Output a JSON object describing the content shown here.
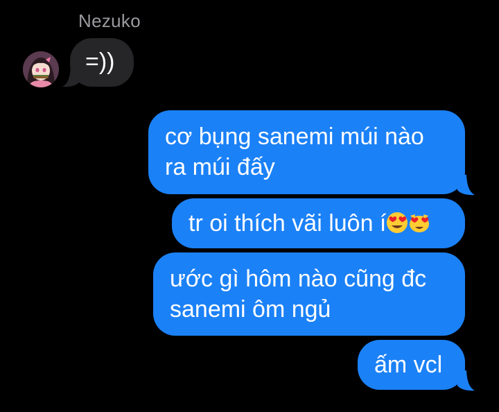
{
  "conversation": {
    "contact_name": "Nezuko",
    "messages": [
      {
        "direction": "incoming",
        "lines": [
          "=))"
        ]
      },
      {
        "direction": "outgoing",
        "lines": [
          "cơ bụng sanemi múi nào",
          "ra múi đấy"
        ]
      },
      {
        "direction": "outgoing",
        "text": "tr oi thích vãi luôn í",
        "emojis": [
          "smiling-face-with-heart-eyes",
          "smiling-cat-with-heart-eyes"
        ]
      },
      {
        "direction": "outgoing",
        "lines": [
          "ước gì hôm nào cũng đc",
          "sanemi ôm ngủ"
        ]
      },
      {
        "direction": "outgoing",
        "lines": [
          "ấm vcl"
        ]
      }
    ]
  },
  "colors": {
    "background": "#000000",
    "incoming_bubble": "#262629",
    "outgoing_bubble": "#1b81f7",
    "sender_name": "#9a9a9f"
  },
  "avatar_icon": "anime-girl-avatar-icon"
}
